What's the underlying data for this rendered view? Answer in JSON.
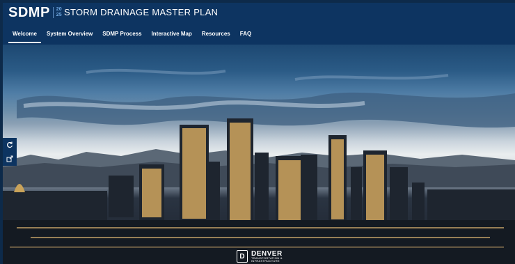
{
  "header": {
    "logo_text": "SDMP",
    "logo_year_top": "20",
    "logo_year_bottom": "25",
    "title": "STORM DRAINAGE MASTER PLAN"
  },
  "nav": {
    "tabs": [
      {
        "label": "Welcome",
        "active": true
      },
      {
        "label": "System Overview",
        "active": false
      },
      {
        "label": "SDMP Process",
        "active": false
      },
      {
        "label": "Interactive Map",
        "active": false
      },
      {
        "label": "Resources",
        "active": false
      },
      {
        "label": "FAQ",
        "active": false
      }
    ]
  },
  "side_tools": [
    {
      "icon": "refresh-icon"
    },
    {
      "icon": "share-icon"
    }
  ],
  "footer_logo": {
    "name": "DENVER",
    "subtitle_line1": "TRANSPORTATION &",
    "subtitle_line2": "INFRASTRUCTURE",
    "mark": "D"
  },
  "colors": {
    "header_bg": "#0d3461",
    "accent": "#6fa7e0",
    "text": "#ffffff"
  }
}
